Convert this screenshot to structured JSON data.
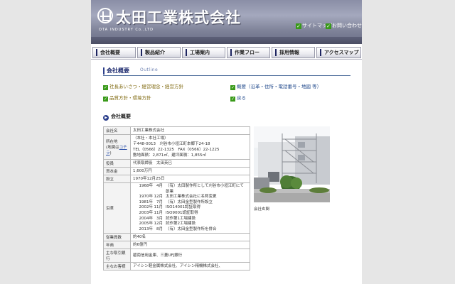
{
  "header": {
    "company_name": "太田工業株式会社",
    "company_name_en": "OTA INDUSTRY Co.,LTD",
    "sitemap_label": "サイトマップ",
    "contact_label": "お問い合わせ"
  },
  "nav": {
    "items": [
      "会社概要",
      "製品紹介",
      "工場案内",
      "作業フロー",
      "採用情報",
      "アクセスマップ"
    ]
  },
  "section": {
    "title": "会社概要",
    "subtitle": "Outline"
  },
  "links": {
    "policy": "社長あいさつ・経営理念・経営方針",
    "outline": "概要（沿革・住所・電話番号・地図 等）",
    "quality": "品質方針・環境方針",
    "back": "戻る"
  },
  "subheading": "会社概要",
  "table": {
    "rows": [
      {
        "key": "会社名",
        "value": "太田工業株式会社"
      },
      {
        "key": "所在地\n(地図はコチラ)",
        "map_link": "コチラ"
      },
      {
        "key": "役員",
        "value": "代表取締役　太田英巳"
      },
      {
        "key": "資本金",
        "value": "1,600万円"
      },
      {
        "key": "設立",
        "value": "1970年12月25日"
      },
      {
        "key": "沿革"
      },
      {
        "key": "従業員数",
        "value": "約40名"
      },
      {
        "key": "年商",
        "value": "約6億円"
      },
      {
        "key": "主な取引銀行",
        "value": "碧南信用金庫、三菱UFJ銀行"
      },
      {
        "key": "主なお客様",
        "value": "アイシン軽金属株式会社、アイシン精機株式会社、"
      }
    ],
    "address": {
      "line1": "（本社・本社工場）",
      "line2": "〒448-0013　刈谷市小垣江町本郷下24-18",
      "line3": "TEL（0566）22-1325　FAX（0566）22-1225",
      "line4": "敷地面積：2,871㎡、建坪面積：1,855㎡"
    },
    "history": [
      {
        "year": "1968年",
        "month": "4月",
        "event": "（有）太田製作所として刈谷市小垣江町にて"
      },
      {
        "year": "",
        "month": "",
        "event": "創業"
      },
      {
        "year": "1970年",
        "month": "12月",
        "event": "太田工業株式会社に名称変更"
      },
      {
        "year": "1981年",
        "month": "7月",
        "event": "（有）太田金型製作所設立"
      },
      {
        "year": "2002年",
        "month": "11月",
        "event": "ISO14001認証取得"
      },
      {
        "year": "2003年",
        "month": "11月",
        "event": "ISO9001認証取得"
      },
      {
        "year": "2004年",
        "month": "3月",
        "event": "試作第1工場建設"
      },
      {
        "year": "2005年",
        "month": "12月",
        "event": "試作第2工場建設"
      },
      {
        "year": "2013年",
        "month": "8月",
        "event": "（有）太田金型製作所を併合"
      }
    ]
  },
  "photo": {
    "caption": "会社玄関"
  },
  "colors": {
    "header": "#8a8ea6",
    "nav_accent": "#1d2460",
    "link": "#224a8c",
    "check": "#3a9a1a"
  }
}
